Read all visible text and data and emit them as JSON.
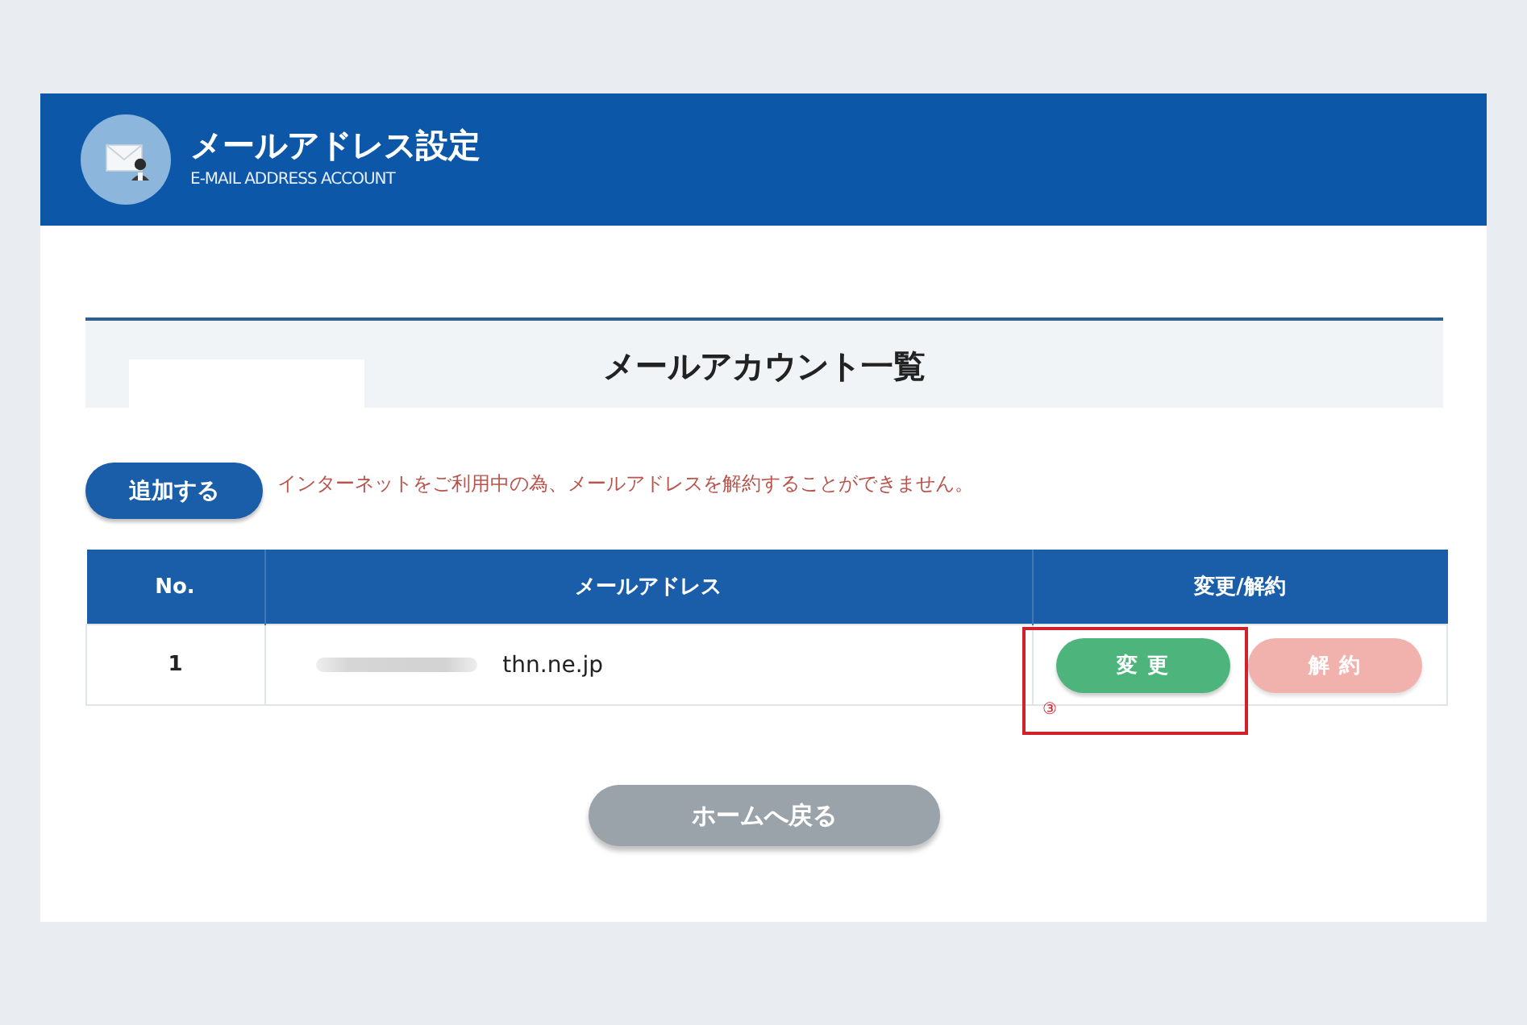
{
  "header": {
    "title": "メールアドレス設定",
    "subtitle": "E-MAIL ADDRESS ACCOUNT"
  },
  "section": {
    "title": "メールアカウント一覧"
  },
  "add_button": {
    "label": "追加する"
  },
  "notice": "インターネットをご利用中の為、メールアドレスを解約することができません。",
  "table": {
    "columns": [
      "No.",
      "メールアドレス",
      "変更/解約"
    ],
    "rows": [
      {
        "no": "1",
        "email": "thn.ne.jp",
        "actions": [
          {
            "kind": "change",
            "label": "変更",
            "disabled": false
          },
          {
            "kind": "cancel",
            "label": "解約",
            "disabled": true
          }
        ]
      }
    ]
  },
  "annotation": {
    "label": "③"
  },
  "home_button": {
    "label": "ホームへ戻る"
  }
}
